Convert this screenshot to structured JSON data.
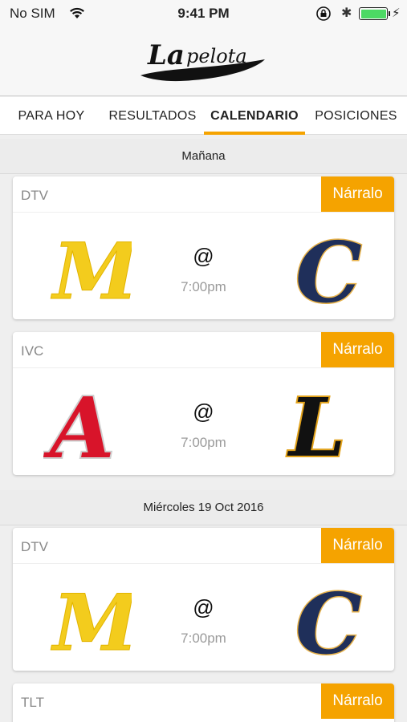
{
  "status_bar": {
    "carrier": "No SIM",
    "time": "9:41 PM",
    "battery_level": 1.0
  },
  "app": {
    "logo_text": "La pelota",
    "accent_color": "#f5a300"
  },
  "tabs": [
    {
      "label": "PARA HOY",
      "active": false
    },
    {
      "label": "RESULTADOS",
      "active": false
    },
    {
      "label": "CALENDARIO",
      "active": true
    },
    {
      "label": "POSICIONES",
      "active": false
    }
  ],
  "sections": [
    {
      "date": "Mañana",
      "games": [
        {
          "channel": "DTV",
          "action": "Nárralo",
          "away_team_logo": "magallanes-m-logo",
          "home_team_logo": "caracas-c-logo",
          "separator": "@",
          "time": "7:00pm"
        },
        {
          "channel": "IVC",
          "action": "Nárralo",
          "away_team_logo": "anzoategui-a-logo",
          "home_team_logo": "lara-l-logo",
          "separator": "@",
          "time": "7:00pm"
        }
      ]
    },
    {
      "date": "Miércoles 19 Oct  2016",
      "games": [
        {
          "channel": "DTV",
          "action": "Nárralo",
          "away_team_logo": "magallanes-m-logo",
          "home_team_logo": "caracas-c-logo",
          "separator": "@",
          "time": "7:00pm"
        },
        {
          "channel": "TLT",
          "action": "Nárralo"
        }
      ]
    }
  ]
}
